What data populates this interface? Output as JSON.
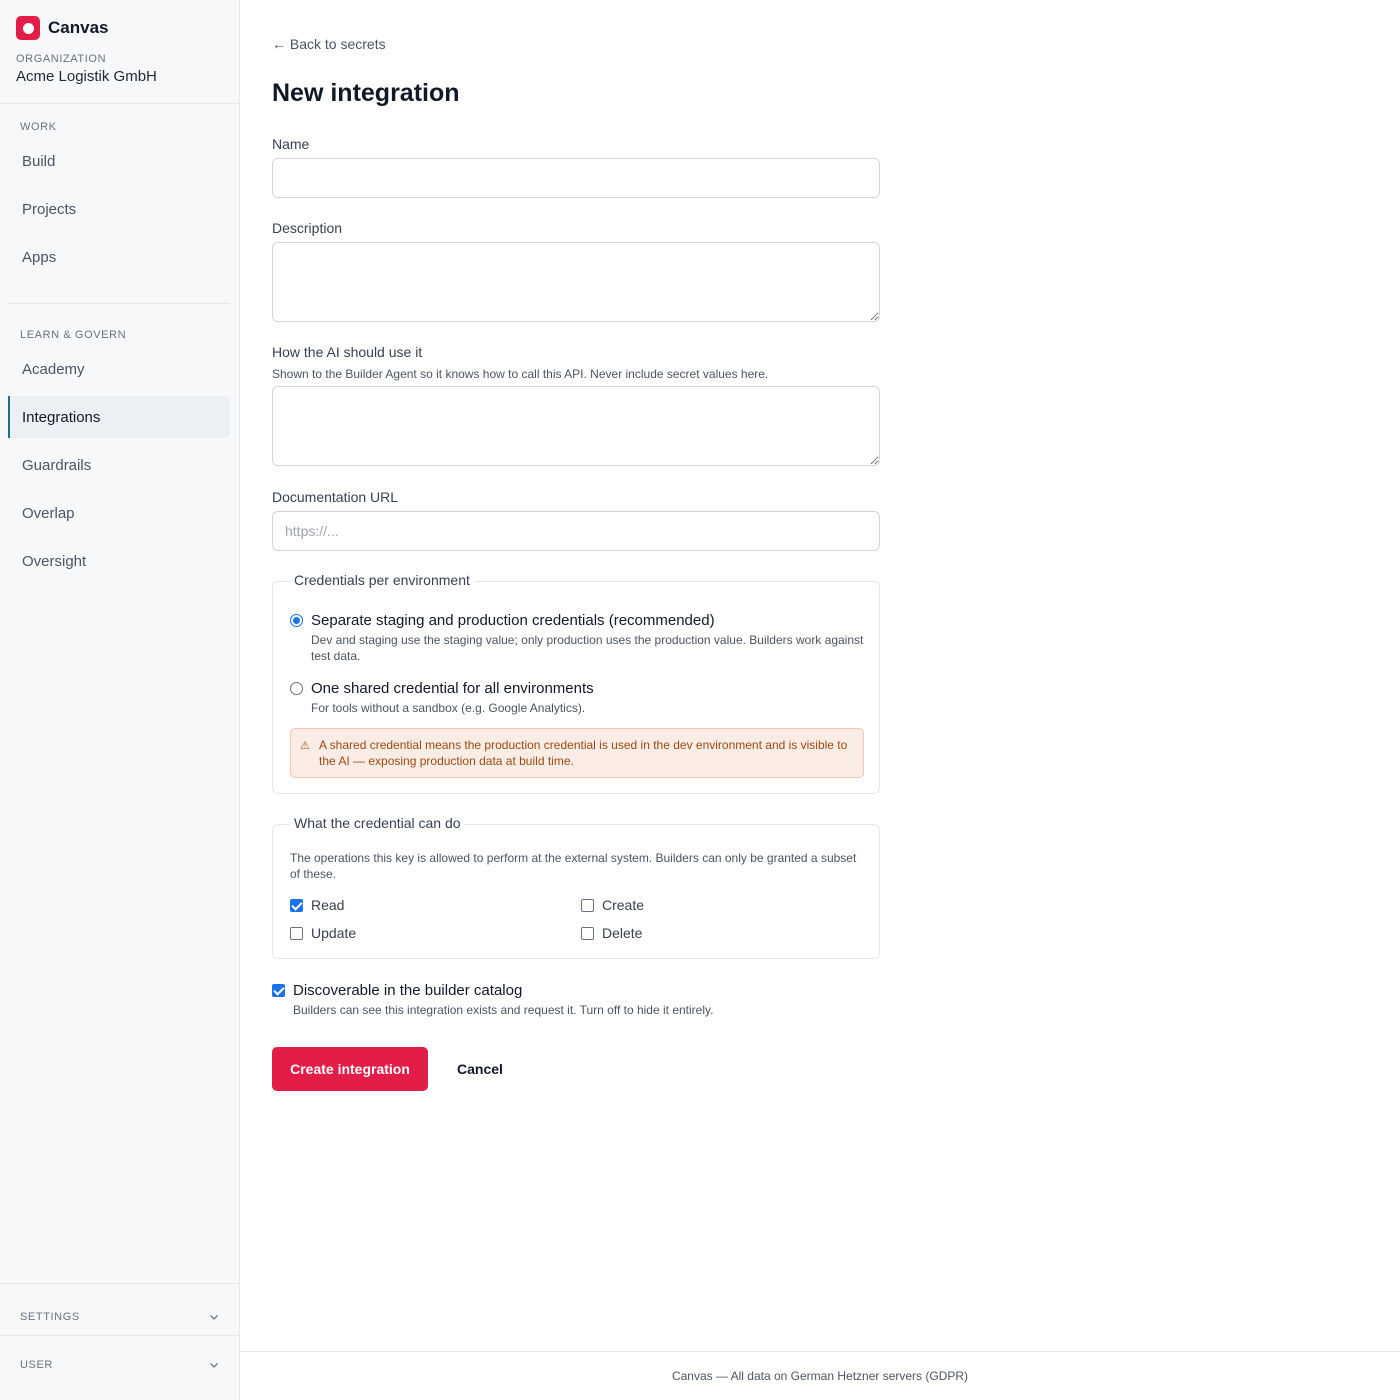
{
  "sidebar": {
    "app_name": "Canvas",
    "org_label": "ORGANIZATION",
    "org_name": "Acme Logistik GmbH",
    "sections": [
      {
        "label": "WORK",
        "items": [
          "Build",
          "Projects",
          "Apps"
        ]
      },
      {
        "label": "LEARN & GOVERN",
        "items": [
          "Academy",
          "Integrations",
          "Guardrails",
          "Overlap",
          "Oversight"
        ]
      }
    ],
    "active_item": "Integrations",
    "settings_label": "SETTINGS",
    "user_label": "USER"
  },
  "main": {
    "back_link": "← Back to secrets",
    "title": "New integration",
    "name_label": "Name",
    "description_label": "Description",
    "ai_usage_label": "How the AI should use it",
    "ai_usage_help": "Shown to the Builder Agent so it knows how to call this API. Never include secret values here.",
    "doc_url_label": "Documentation URL",
    "doc_url_placeholder": "https://...",
    "credentials": {
      "legend": "Credentials per environment",
      "options": [
        {
          "title": "Separate staging and production credentials (recommended)",
          "description": "Dev and staging use the staging value; only production uses the production value. Builders work against test data.",
          "selected": true
        },
        {
          "title": "One shared credential for all environments",
          "description": "For tools without a sandbox (e.g. Google Analytics).",
          "selected": false
        }
      ],
      "warning": "A shared credential means the production credential is used in the dev environment and is visible to the AI — exposing production data at build time."
    },
    "permissions": {
      "legend": "What the credential can do",
      "description": "The operations this key is allowed to perform at the external system. Builders can only be granted a subset of these.",
      "read": {
        "label": "Read",
        "checked": true
      },
      "create": {
        "label": "Create",
        "checked": false
      },
      "update": {
        "label": "Update",
        "checked": false
      },
      "delete": {
        "label": "Delete",
        "checked": false
      }
    },
    "discoverable": {
      "label": "Discoverable in the builder catalog",
      "description": "Builders can see this integration exists and request it. Turn off to hide it entirely.",
      "checked": true
    },
    "create_button": "Create integration",
    "cancel_button": "Cancel"
  },
  "footer": "Canvas — All data on German Hetzner servers (GDPR)",
  "colors": {
    "accent": "#e11d48",
    "active_indicator": "#1f6f8b",
    "checkbox": "#1a73e8",
    "warning_bg": "#fbece5",
    "warning_text": "#9a4a12"
  },
  "icons": {
    "logo": "canvas-logo-icon",
    "back": "arrow-left-icon",
    "warning": "warning-triangle-icon",
    "collapse": "chevron-down-icon"
  }
}
